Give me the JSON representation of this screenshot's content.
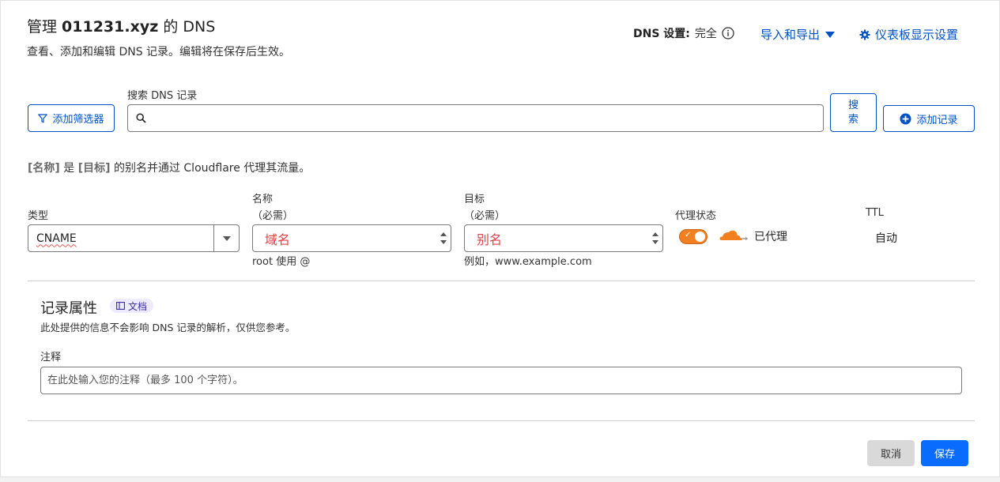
{
  "header": {
    "title_prefix": "管理 ",
    "domain": "011231.xyz",
    "title_suffix": " 的 DNS",
    "subtitle": "查看、添加和编辑 DNS 记录。编辑将在保存后生效。",
    "dns_setting_label": "DNS 设置:",
    "dns_setting_value": "完全",
    "import_export": "导入和导出",
    "dashboard_settings": "仪表板显示设置"
  },
  "search": {
    "label": "搜索 DNS 记录",
    "placeholder": "",
    "filter_button": "添加筛选器",
    "search_button_line1": "搜",
    "search_button_line2": "索",
    "add_record_button": "添加记录"
  },
  "form": {
    "description_name": "[名称]",
    "description_is": " 是 ",
    "description_target": "[目标]",
    "description_rest": " 的别名并通过 Cloudflare 代理其流量。",
    "type_label": "类型",
    "type_value": "CNAME",
    "name_label": "名称",
    "name_required": "（必需）",
    "name_placeholder": "域名",
    "name_hint": "root 使用 @",
    "target_label": "目标",
    "target_required": "（必需）",
    "target_placeholder": "别名",
    "target_hint": "例如，www.example.com",
    "proxy_label": "代理状态",
    "proxy_value": "已代理",
    "ttl_label": "TTL",
    "ttl_value": "自动"
  },
  "attributes": {
    "title": "记录属性",
    "doc_badge": "文档",
    "description": "此处提供的信息不会影响 DNS 记录的解析，仅供您参考。",
    "note_label": "注释",
    "note_placeholder": "在此处输入您的注释（最多 100 个字符）。"
  },
  "actions": {
    "cancel": "取消",
    "save": "保存"
  },
  "colors": {
    "accent": "#0051c3",
    "proxy_orange": "#f38020",
    "save_blue": "#0a6cff",
    "required_red": "#e0404a"
  }
}
